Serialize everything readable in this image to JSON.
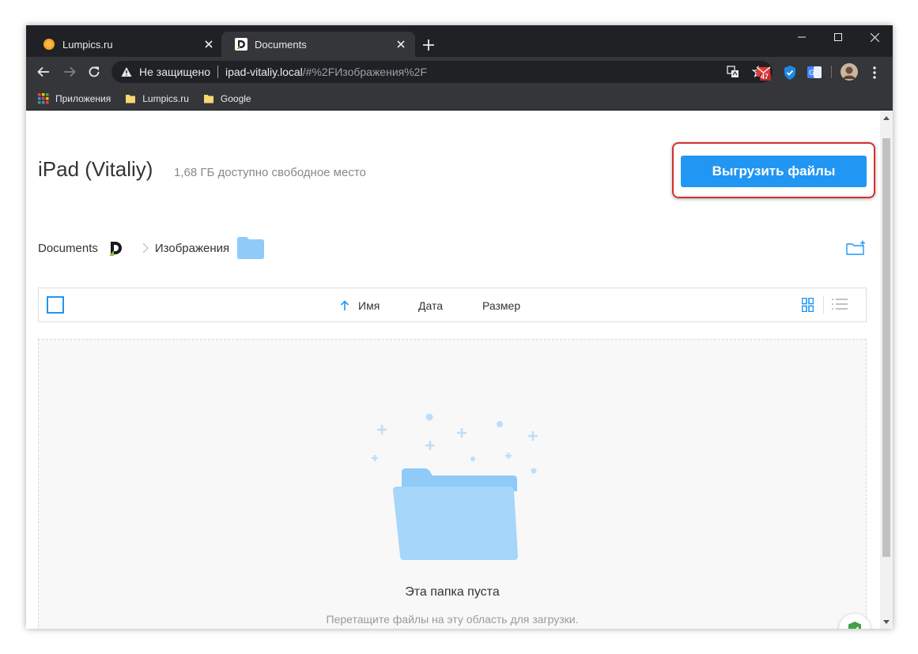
{
  "browser": {
    "tabs": [
      {
        "title": "Lumpics.ru",
        "active": false
      },
      {
        "title": "Documents",
        "active": true
      }
    ],
    "address": {
      "security_label": "Не защищено",
      "host": "ipad-vitaliy.local",
      "path": "/#%2FИзображения%2F"
    },
    "extension_badge": "47",
    "bookmarks": [
      {
        "label": "Приложения",
        "icon": "apps-grid-icon"
      },
      {
        "label": "Lumpics.ru",
        "icon": "folder-icon"
      },
      {
        "label": "Google",
        "icon": "folder-icon"
      }
    ]
  },
  "page": {
    "device_name": "iPad (Vitaliy)",
    "free_space": "1,68 ГБ доступно свободное место",
    "upload_button": "Выгрузить файлы",
    "breadcrumb": {
      "root": "Documents",
      "current": "Изображения"
    },
    "columns": {
      "name": "Имя",
      "date": "Дата",
      "size": "Размер"
    },
    "sort": {
      "column": "name",
      "direction": "ascending"
    },
    "empty_state": {
      "title": "Эта папка пуста",
      "hint": "Перетащите файлы на эту область для загрузки."
    }
  },
  "colors": {
    "accent": "#2196f3",
    "highlight": "#d32f2f",
    "folder": "#90caf9"
  }
}
